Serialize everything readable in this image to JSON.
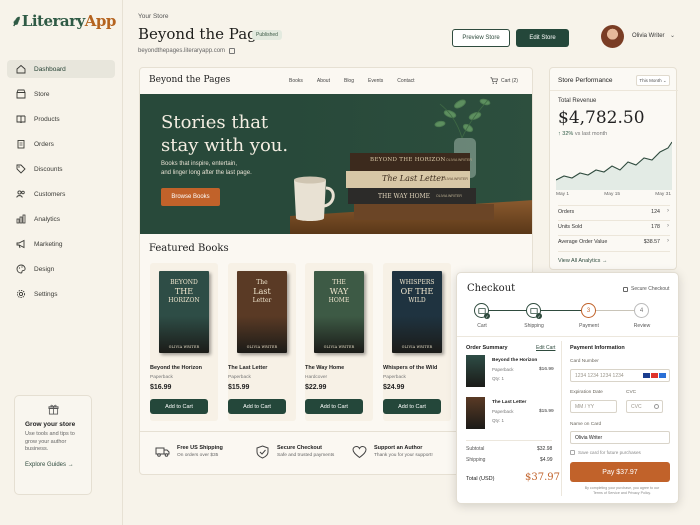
{
  "brand": {
    "prefix": "Literary",
    "suffix": "App"
  },
  "sidebar": {
    "items": [
      {
        "label": "Dashboard",
        "icon": "home-icon"
      },
      {
        "label": "Store",
        "icon": "store-icon"
      },
      {
        "label": "Products",
        "icon": "book-icon"
      },
      {
        "label": "Orders",
        "icon": "clipboard-icon"
      },
      {
        "label": "Discounts",
        "icon": "tag-icon"
      },
      {
        "label": "Customers",
        "icon": "users-icon"
      },
      {
        "label": "Analytics",
        "icon": "bar-chart-icon"
      },
      {
        "label": "Marketing",
        "icon": "megaphone-icon"
      },
      {
        "label": "Design",
        "icon": "palette-icon"
      },
      {
        "label": "Settings",
        "icon": "gear-icon"
      }
    ],
    "grow": {
      "title": "Grow your store",
      "text": "Use tools and tips to grow your author business.",
      "link": "Explore Guides"
    }
  },
  "header": {
    "eyebrow": "Your Store",
    "store_name": "Beyond the Pages",
    "status": "Published",
    "url": "beyondthepages.literaryapp.com",
    "preview_label": "Preview Store",
    "edit_label": "Edit Store",
    "user_name": "Olivia Writer"
  },
  "store": {
    "name": "Beyond the Pages",
    "nav": [
      "Books",
      "About",
      "Blog",
      "Events",
      "Contact"
    ],
    "cart": "Cart (2)",
    "hero_title_1": "Stories that",
    "hero_title_2": "stay with you.",
    "hero_sub_1": "Books that inspire, entertain,",
    "hero_sub_2": "and linger long after the last page.",
    "hero_button": "Browse Books",
    "featured_title": "Featured Books",
    "add_label": "Add to Cart",
    "books": [
      {
        "t1": "BEYOND",
        "t2": "THE",
        "t3": "HORIZON",
        "title": "Beyond the Horizon",
        "format": "Paperback",
        "price": "$16.99",
        "color": "#2e4d46"
      },
      {
        "t1": "The",
        "t2": "Last",
        "t3": "Letter",
        "title": "The Last Letter",
        "format": "Paperback",
        "price": "$15.99",
        "color": "#5a3a25"
      },
      {
        "t1": "THE",
        "t2": "WAY",
        "t3": "HOME",
        "title": "The Way Home",
        "format": "Hardcover",
        "price": "$22.99",
        "color": "#3d5a45"
      },
      {
        "t1": "WHISPERS",
        "t2": "OF THE",
        "t3": "WILD",
        "title": "Whispers of the Wild",
        "format": "Paperback",
        "price": "$24.99",
        "color": "#1f3340"
      }
    ],
    "book_author": "OLIVIA WRITER",
    "spines": [
      "BEYOND THE HORIZON",
      "The Last Letter",
      "THE WAY HOME"
    ],
    "spine_author": "OLIVIA WRITER",
    "features": [
      {
        "title": "Free US Shipping",
        "sub": "On orders over $35",
        "icon": "truck-icon"
      },
      {
        "title": "Secure Checkout",
        "sub": "Safe and trusted payments",
        "icon": "shield-check-icon"
      },
      {
        "title": "Support an Author",
        "sub": "Thank you for your support!",
        "icon": "heart-icon"
      }
    ]
  },
  "performance": {
    "title": "Store Performance",
    "period": "This Month",
    "revenue_label": "Total Revenue",
    "revenue": "$4,782.50",
    "change": "32%",
    "change_note": "vs last month",
    "x_labels": [
      "May 1",
      "May 15",
      "May 31"
    ],
    "stats": [
      {
        "label": "Orders",
        "value": "124"
      },
      {
        "label": "Units Sold",
        "value": "178"
      },
      {
        "label": "Average Order Value",
        "value": "$38.57"
      }
    ],
    "link": "View All Analytics"
  },
  "checkout": {
    "title": "Checkout",
    "secure": "Secure Checkout",
    "steps": [
      {
        "label": "Cart",
        "num": ""
      },
      {
        "label": "Shipping",
        "num": ""
      },
      {
        "label": "Payment",
        "num": "3"
      },
      {
        "label": "Review",
        "num": "4"
      }
    ],
    "summary_title": "Order Summary",
    "edit_cart": "Edit Cart",
    "items": [
      {
        "title": "Beyond the Horizon",
        "format": "Paperback",
        "qty": "Qty: 1",
        "price": "$16.99"
      },
      {
        "title": "The Last Letter",
        "format": "Paperback",
        "qty": "Qty: 1",
        "price": "$15.99"
      }
    ],
    "subtotal_label": "Subtotal",
    "subtotal": "$32.98",
    "shipping_label": "Shipping",
    "shipping": "$4.99",
    "total_label": "Total (USD)",
    "total": "$37.97",
    "payment_title": "Payment Information",
    "card_label": "Card Number",
    "card_placeholder": "1234 1234 1234 1234",
    "exp_label": "Expiration Date",
    "exp_placeholder": "MM / YY",
    "cvc_label": "CVC",
    "cvc_placeholder": "CVC",
    "name_label": "Name on Card",
    "name_value": "Olivia Writer",
    "save_label": "Save card for future purchases",
    "pay_label": "Pay $37.97",
    "terms": "By completing your purchase, you agree to our Terms of Service and Privacy Policy."
  },
  "colors": {
    "green": "#24473a",
    "orange": "#c1622a",
    "cream": "#f7f3ea"
  }
}
